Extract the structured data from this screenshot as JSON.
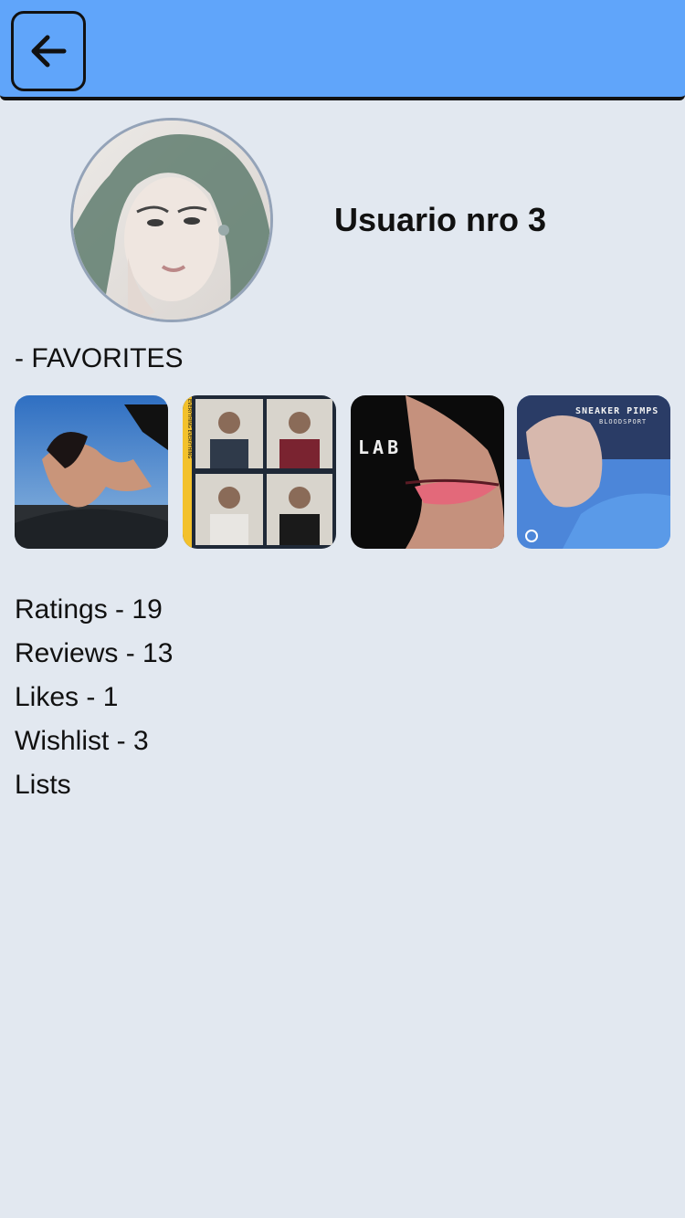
{
  "header": {
    "back_icon": "arrow-left-icon",
    "accent_color": "#60a5fa"
  },
  "profile": {
    "username": "Usuario nro 3"
  },
  "favorites": {
    "heading": "- FAVORITES",
    "albums": [
      {
        "art_text": ""
      },
      {
        "art_text": "EVERYTHING EVERYTHING"
      },
      {
        "art_text": "LAB"
      },
      {
        "art_text": "SNEAKER PIMPS",
        "art_subtext": "BLOODSPORT"
      }
    ]
  },
  "stats": {
    "ratings": "Ratings - 19",
    "reviews": "Reviews - 13",
    "likes": "Likes - 1",
    "wishlist": "Wishlist - 3",
    "lists": "Lists"
  }
}
